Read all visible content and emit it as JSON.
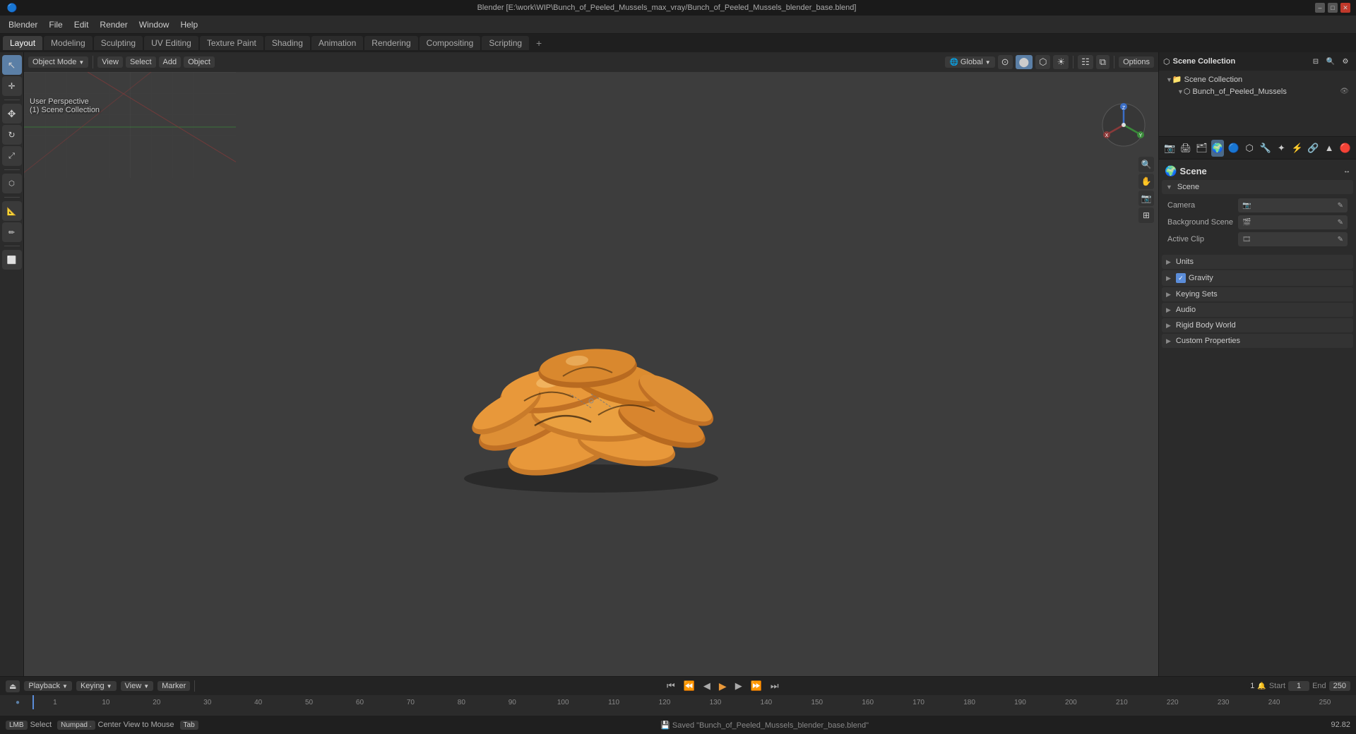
{
  "window": {
    "title": "Blender [E:\\work\\WIP\\Bunch_of_Peeled_Mussels_max_vray/Bunch_of_Peeled_Mussels_blender_base.blend]",
    "controls": [
      "–",
      "□",
      "✕"
    ]
  },
  "menubar": {
    "items": [
      "Blender",
      "File",
      "Edit",
      "Render",
      "Window",
      "Help"
    ]
  },
  "workspace_tabs": {
    "tabs": [
      "Layout",
      "Modeling",
      "Sculpting",
      "UV Editing",
      "Texture Paint",
      "Shading",
      "Animation",
      "Rendering",
      "Compositing",
      "Scripting"
    ],
    "active": "Layout",
    "add_label": "+"
  },
  "viewport_header": {
    "mode": "Object Mode",
    "view": "View",
    "select": "Select",
    "add": "Add",
    "object": "Object",
    "global": "Global",
    "options": "Options"
  },
  "viewport_info": {
    "line1": "User Perspective",
    "line2": "(1) Scene Collection"
  },
  "gizmo": {
    "y_label": "Y",
    "x_label": "X",
    "z_label": "Z"
  },
  "outliner": {
    "title": "Scene Collection",
    "items": [
      {
        "name": "Bunch_of_Peeled_Mussels",
        "type": "collection",
        "visible": true
      }
    ]
  },
  "properties": {
    "title": "Scene",
    "panel_title": "Scene",
    "sections": [
      {
        "id": "scene",
        "label": "Scene",
        "expanded": true,
        "fields": [
          {
            "label": "Camera",
            "value": "",
            "icon": "📷",
            "editable": true
          },
          {
            "label": "Background Scene",
            "value": "",
            "icon": "🎬",
            "editable": true
          },
          {
            "label": "Active Clip",
            "value": "",
            "icon": "🎞️",
            "editable": true
          }
        ]
      },
      {
        "id": "units",
        "label": "Units",
        "expanded": false,
        "fields": []
      },
      {
        "id": "gravity",
        "label": "Gravity",
        "expanded": false,
        "fields": [],
        "checkbox": true,
        "checked": true
      },
      {
        "id": "keying_sets",
        "label": "Keying Sets",
        "expanded": false,
        "fields": []
      },
      {
        "id": "audio",
        "label": "Audio",
        "expanded": false,
        "fields": []
      },
      {
        "id": "rigid_body_world",
        "label": "Rigid Body World",
        "expanded": false,
        "fields": []
      },
      {
        "id": "custom_properties",
        "label": "Custom Properties",
        "expanded": false,
        "fields": []
      }
    ]
  },
  "timeline": {
    "playback_label": "Playback",
    "keying_label": "Keying",
    "view_label": "View",
    "marker_label": "Marker",
    "start_label": "Start",
    "end_label": "End",
    "start_val": "1",
    "end_val": "250",
    "current_frame": "1",
    "frame_numbers": [
      "1",
      "10",
      "20",
      "30",
      "40",
      "50",
      "60",
      "70",
      "80",
      "90",
      "100",
      "110",
      "120",
      "130",
      "140",
      "150",
      "160",
      "170",
      "180",
      "190",
      "200",
      "210",
      "220",
      "230",
      "240",
      "250"
    ]
  },
  "statusbar": {
    "select_label": "Select",
    "center_view_label": "Center View to Mouse",
    "saved_message": "Saved \"Bunch_of_Peeled_Mussels_blender_base.blend\"",
    "version": "92.82"
  },
  "props_sidebar_icons": [
    "🔧",
    "📷",
    "🌍",
    "🎨",
    "🔴",
    "🔵",
    "⚡",
    "📊",
    "🔲"
  ],
  "left_toolbar_icons": [
    {
      "icon": "↖",
      "name": "select-tool",
      "active": true
    },
    {
      "icon": "✥",
      "name": "move-tool",
      "active": false
    },
    {
      "icon": "↻",
      "name": "rotate-tool",
      "active": false
    },
    {
      "icon": "⤢",
      "name": "scale-tool",
      "active": false
    },
    "sep",
    {
      "icon": "⬡",
      "name": "transform-tool",
      "active": false
    },
    "sep",
    {
      "icon": "📐",
      "name": "measure-tool",
      "active": false
    },
    {
      "icon": "⬜",
      "name": "annotate-tool",
      "active": false
    }
  ]
}
